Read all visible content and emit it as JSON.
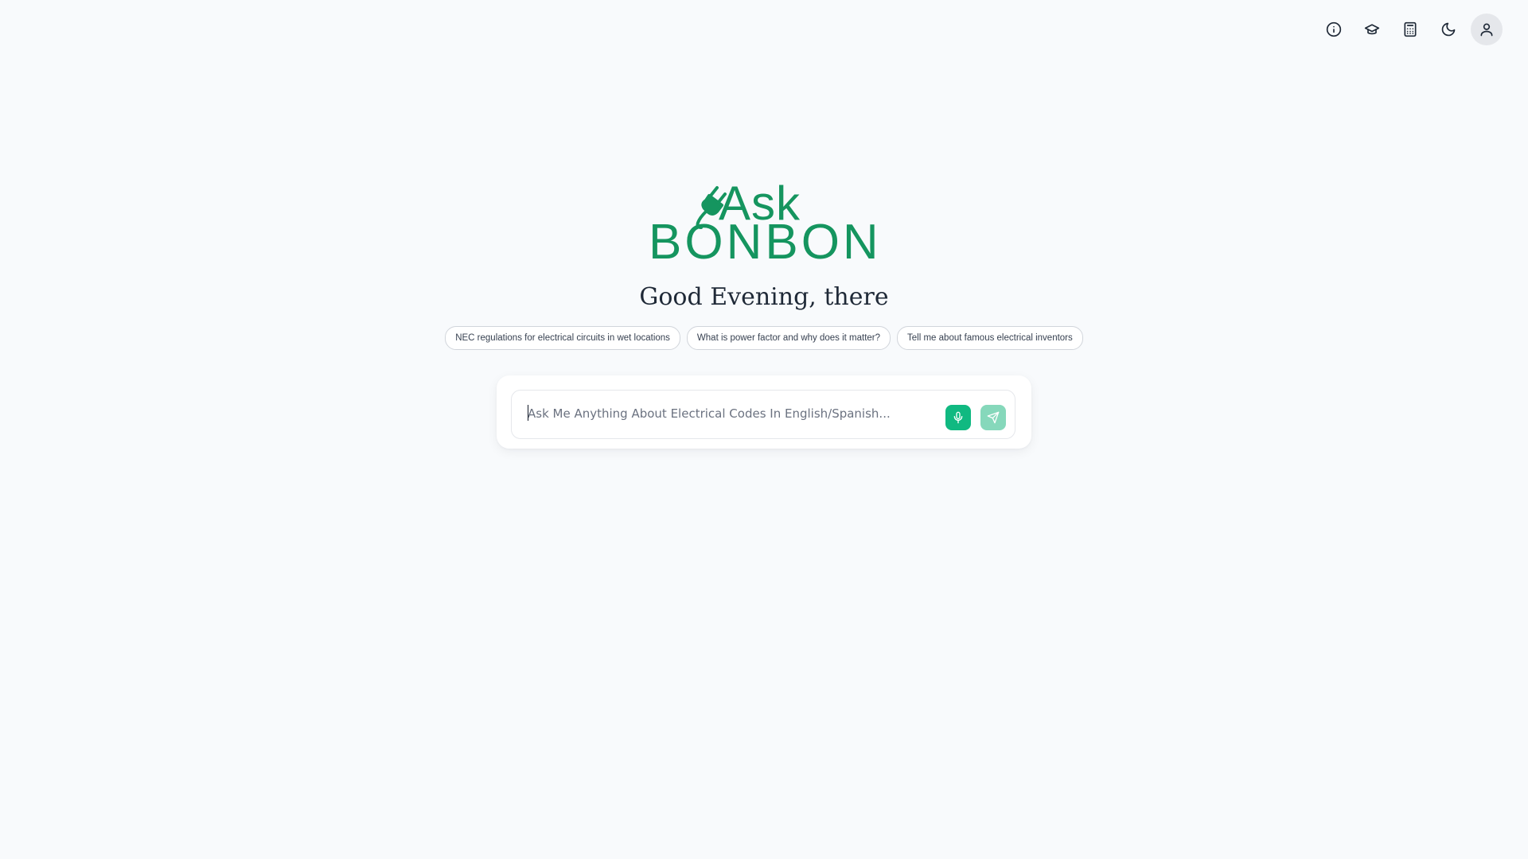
{
  "header": {
    "icons": [
      {
        "name": "info-icon"
      },
      {
        "name": "graduation-cap-icon"
      },
      {
        "name": "calculator-icon"
      },
      {
        "name": "moon-icon"
      },
      {
        "name": "user-icon"
      }
    ]
  },
  "logo": {
    "line1": "Ask",
    "line2": "BONBON",
    "icon": "plug-icon",
    "color": "#15955f"
  },
  "greeting": "Good Evening, there",
  "suggestions": [
    "NEC regulations for electrical circuits in wet locations",
    "What is power factor and why does it matter?",
    "Tell me about famous electrical inventors"
  ],
  "chat_input": {
    "placeholder": "Ask Me Anything About Electrical Codes In English/Spanish...",
    "value": "",
    "mic_icon": "microphone-icon",
    "send_icon": "send-icon"
  },
  "colors": {
    "accent": "#10b981",
    "accent_muted": "#86d8bb",
    "background": "#f8fafc"
  }
}
